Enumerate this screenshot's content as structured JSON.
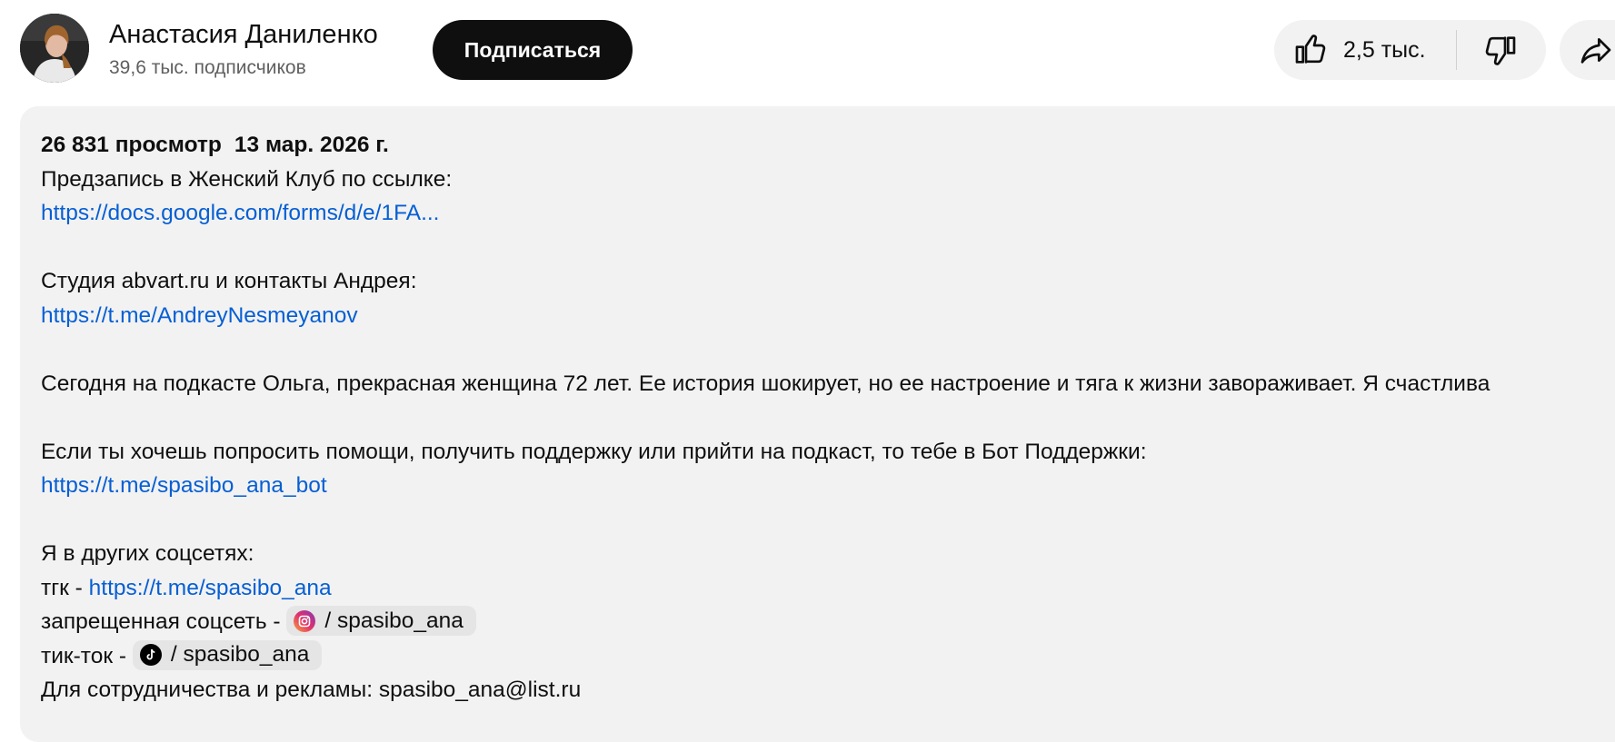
{
  "channel": {
    "name": "Анастасия Даниленко",
    "subscribers": "39,6 тыс. подписчиков",
    "subscribe_label": "Подписаться"
  },
  "actions": {
    "like_count": "2,5 тыс.",
    "like_icon": "thumb-up-icon",
    "dislike_icon": "thumb-down-icon",
    "share_icon": "share-icon"
  },
  "description": {
    "views": "26 831 просмотр",
    "date": "13 мар. 2026 г.",
    "preorder_text": "Предзапись в Женский Клуб по ссылке:",
    "preorder_link": "https://docs.google.com/forms/d/e/1FA...",
    "studio_text": "Студия abvart.ru и контакты Андрея:",
    "studio_link": "https://t.me/AndreyNesmeyanov",
    "episode_text": "Сегодня на подкасте Ольга, прекрасная женщина 72 лет. Ее история шокирует, но ее настроение и тяга к жизни завораживает. Я счастлива",
    "help_text": "Если ты хочешь попросить помощи, получить поддержку или прийти на подкаст, то тебе в Бот Поддержки:",
    "help_link": "https://t.me/spasibo_ana_bot",
    "socials_heading": "Я в других соцсетях:",
    "tg_label": "тгк - ",
    "tg_link": "https://t.me/spasibo_ana",
    "insta_label": "запрещенная соцсеть - ",
    "insta_chip": "/ spasibo_ana",
    "tiktok_label": "тик-ток - ",
    "tiktok_chip": "/ spasibo_ana",
    "ads_text": "Для сотрудничества и рекламы: spasibo_ana@list.ru"
  },
  "colors": {
    "link": "#065fd4",
    "panel_bg": "#f2f2f2",
    "button_dark": "#0f0f0f"
  }
}
